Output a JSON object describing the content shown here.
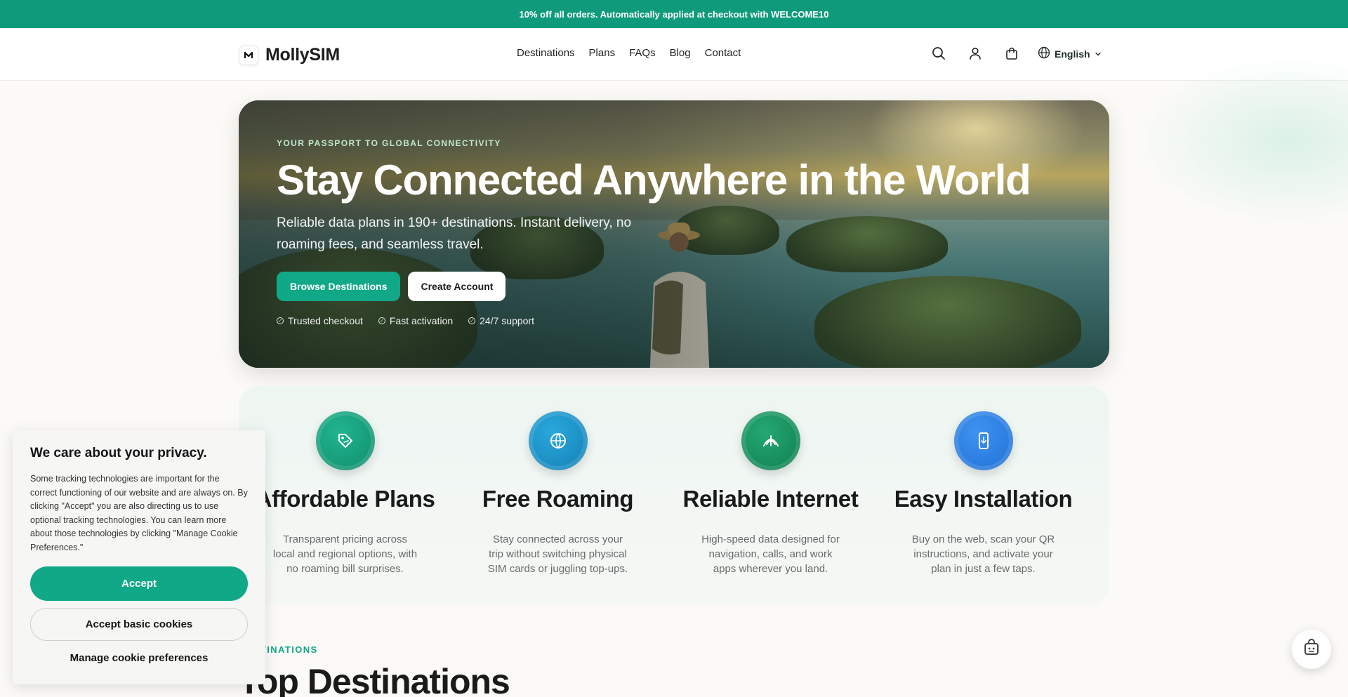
{
  "promo": {
    "text": "10% off all orders. Automatically applied at checkout with WELCOME10"
  },
  "header": {
    "logo_mark": "M",
    "logo_text": "MollySIM",
    "nav": [
      {
        "label": "Destinations"
      },
      {
        "label": "Plans"
      },
      {
        "label": "FAQs"
      },
      {
        "label": "Blog"
      },
      {
        "label": "Contact"
      }
    ],
    "icons": [
      "search-icon",
      "user-icon",
      "cart-icon"
    ],
    "language": "English"
  },
  "hero": {
    "eyebrow": "YOUR PASSPORT TO GLOBAL CONNECTIVITY",
    "title": "Stay Connected Anywhere in the World",
    "subtitle": "Reliable data plans in 190+ destinations. Instant delivery, no roaming fees, and seamless travel.",
    "primary_button": "Browse Destinations",
    "secondary_button": "Create Account",
    "trust": [
      {
        "label": "Trusted checkout"
      },
      {
        "label": "Fast activation"
      },
      {
        "label": "24/7 support"
      }
    ]
  },
  "features": [
    {
      "title": "Affordable Plans",
      "description": "Transparent pricing across local and regional options, with no roaming bill surprises.",
      "icon": "price-tag-icon",
      "color": "#129a78"
    },
    {
      "title": "Free Roaming",
      "description": "Stay connected across your trip without switching physical SIM cards or juggling top-ups.",
      "icon": "globe-icon",
      "color": "#1891c8"
    },
    {
      "title": "Reliable Internet",
      "description": "High-speed data designed for navigation, calls, and work apps wherever you land.",
      "icon": "signal-icon",
      "color": "#158f5f"
    },
    {
      "title": "Easy Installation",
      "description": "Buy on the web, scan your QR instructions, and activate your plan in just a few taps.",
      "icon": "phone-icon",
      "color": "#2a7fe0"
    }
  ],
  "destinations": {
    "eyebrow": "DESTINATIONS",
    "title": "Top Destinations"
  },
  "cookie": {
    "title": "We care about your privacy.",
    "body": "Some tracking technologies are important for the correct functioning of our website and are always on. By clicking \"Accept\" you are also directing us to use optional tracking technologies. You can learn more about those technologies by clicking \"Manage Cookie Preferences.\"",
    "accept": "Accept",
    "accept_basic": "Accept basic cookies",
    "manage": "Manage cookie preferences"
  },
  "colors": {
    "accent": "#11a888",
    "promo_bg": "#0f9a7c"
  }
}
